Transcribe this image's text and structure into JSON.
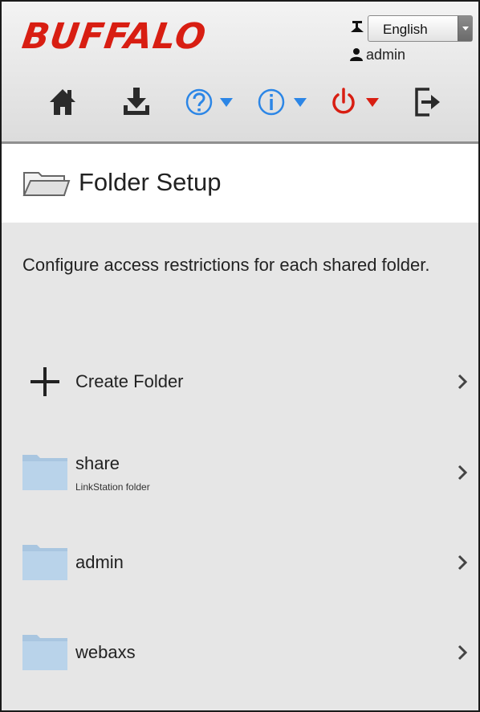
{
  "header": {
    "logo": "BUFFALO",
    "language": "English",
    "user": "admin"
  },
  "toolbar": {
    "icons": [
      "home-icon",
      "download-icon",
      "help-icon",
      "info-icon",
      "power-icon",
      "logout-icon"
    ],
    "colors": {
      "blue": "#2c86e6",
      "red": "#d81e12",
      "dark": "#2a2a2a"
    }
  },
  "page": {
    "title": "Folder Setup",
    "description": "Configure access restrictions for each shared folder."
  },
  "actions": {
    "create_folder": "Create Folder"
  },
  "folders": [
    {
      "name": "share",
      "description": "LinkStation folder"
    },
    {
      "name": "admin"
    },
    {
      "name": "webaxs"
    }
  ]
}
